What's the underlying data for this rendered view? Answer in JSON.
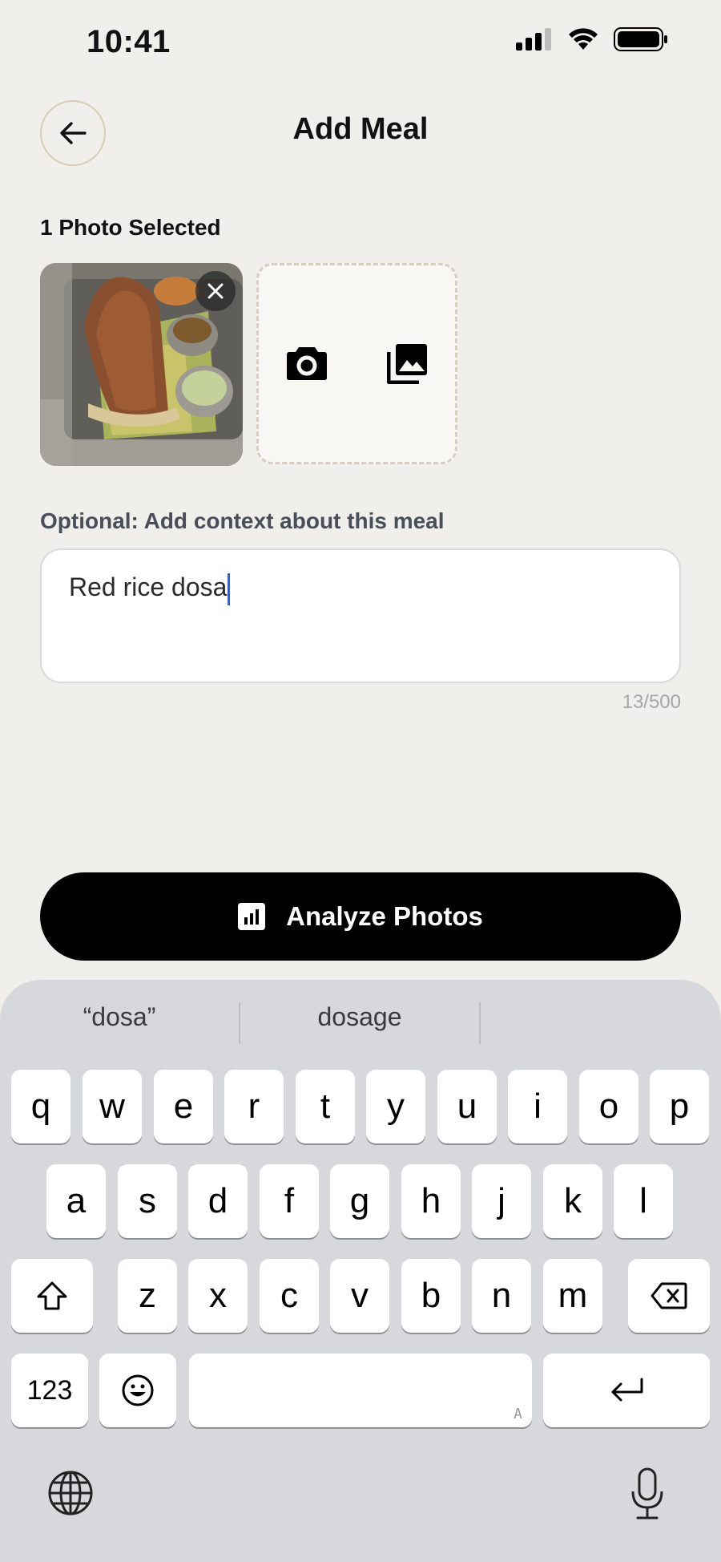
{
  "status_bar": {
    "time": "10:41"
  },
  "header": {
    "title": "Add Meal",
    "back_icon": "arrow-left-icon"
  },
  "photos": {
    "selected_label": "1 Photo Selected",
    "add_camera_icon": "camera-icon",
    "add_gallery_icon": "gallery-icon",
    "remove_icon": "close-icon"
  },
  "context": {
    "label": "Optional: Add context about this meal",
    "value": "Red rice dosa",
    "counter": "13/500"
  },
  "analyze_button": {
    "label": "Analyze Photos",
    "icon": "chart-icon"
  },
  "keyboard": {
    "suggestions": [
      "“dosa”",
      "dosage",
      ""
    ],
    "row1": [
      "q",
      "w",
      "e",
      "r",
      "t",
      "y",
      "u",
      "i",
      "o",
      "p"
    ],
    "row2": [
      "a",
      "s",
      "d",
      "f",
      "g",
      "h",
      "j",
      "k",
      "l"
    ],
    "row3": [
      "z",
      "x",
      "c",
      "v",
      "b",
      "n",
      "m"
    ],
    "numbers_key": "123",
    "space_indicator": "A"
  },
  "colors": {
    "accent_button": "#000000",
    "background": "#f0efeb",
    "caret": "#3b5bdb"
  }
}
